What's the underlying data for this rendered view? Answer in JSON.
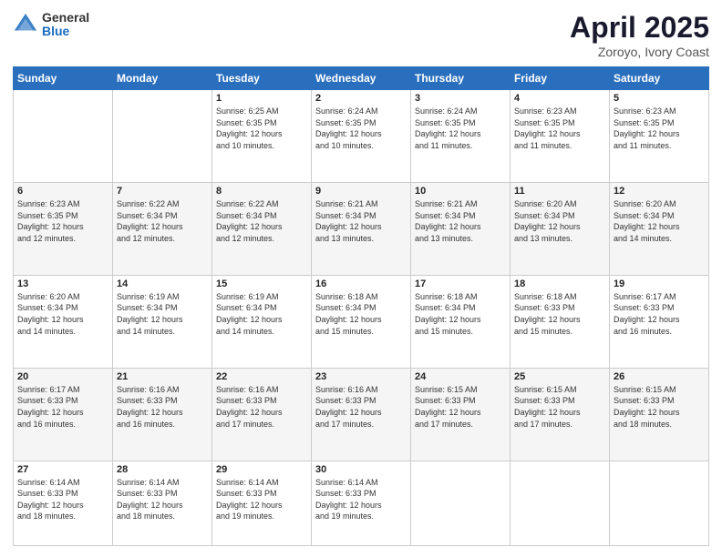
{
  "logo": {
    "general": "General",
    "blue": "Blue"
  },
  "title": "April 2025",
  "location": "Zoroyo, Ivory Coast",
  "days_header": [
    "Sunday",
    "Monday",
    "Tuesday",
    "Wednesday",
    "Thursday",
    "Friday",
    "Saturday"
  ],
  "weeks": [
    [
      {
        "day": "",
        "info": ""
      },
      {
        "day": "",
        "info": ""
      },
      {
        "day": "1",
        "info": "Sunrise: 6:25 AM\nSunset: 6:35 PM\nDaylight: 12 hours\nand 10 minutes."
      },
      {
        "day": "2",
        "info": "Sunrise: 6:24 AM\nSunset: 6:35 PM\nDaylight: 12 hours\nand 10 minutes."
      },
      {
        "day": "3",
        "info": "Sunrise: 6:24 AM\nSunset: 6:35 PM\nDaylight: 12 hours\nand 11 minutes."
      },
      {
        "day": "4",
        "info": "Sunrise: 6:23 AM\nSunset: 6:35 PM\nDaylight: 12 hours\nand 11 minutes."
      },
      {
        "day": "5",
        "info": "Sunrise: 6:23 AM\nSunset: 6:35 PM\nDaylight: 12 hours\nand 11 minutes."
      }
    ],
    [
      {
        "day": "6",
        "info": "Sunrise: 6:23 AM\nSunset: 6:35 PM\nDaylight: 12 hours\nand 12 minutes."
      },
      {
        "day": "7",
        "info": "Sunrise: 6:22 AM\nSunset: 6:34 PM\nDaylight: 12 hours\nand 12 minutes."
      },
      {
        "day": "8",
        "info": "Sunrise: 6:22 AM\nSunset: 6:34 PM\nDaylight: 12 hours\nand 12 minutes."
      },
      {
        "day": "9",
        "info": "Sunrise: 6:21 AM\nSunset: 6:34 PM\nDaylight: 12 hours\nand 13 minutes."
      },
      {
        "day": "10",
        "info": "Sunrise: 6:21 AM\nSunset: 6:34 PM\nDaylight: 12 hours\nand 13 minutes."
      },
      {
        "day": "11",
        "info": "Sunrise: 6:20 AM\nSunset: 6:34 PM\nDaylight: 12 hours\nand 13 minutes."
      },
      {
        "day": "12",
        "info": "Sunrise: 6:20 AM\nSunset: 6:34 PM\nDaylight: 12 hours\nand 14 minutes."
      }
    ],
    [
      {
        "day": "13",
        "info": "Sunrise: 6:20 AM\nSunset: 6:34 PM\nDaylight: 12 hours\nand 14 minutes."
      },
      {
        "day": "14",
        "info": "Sunrise: 6:19 AM\nSunset: 6:34 PM\nDaylight: 12 hours\nand 14 minutes."
      },
      {
        "day": "15",
        "info": "Sunrise: 6:19 AM\nSunset: 6:34 PM\nDaylight: 12 hours\nand 14 minutes."
      },
      {
        "day": "16",
        "info": "Sunrise: 6:18 AM\nSunset: 6:34 PM\nDaylight: 12 hours\nand 15 minutes."
      },
      {
        "day": "17",
        "info": "Sunrise: 6:18 AM\nSunset: 6:34 PM\nDaylight: 12 hours\nand 15 minutes."
      },
      {
        "day": "18",
        "info": "Sunrise: 6:18 AM\nSunset: 6:33 PM\nDaylight: 12 hours\nand 15 minutes."
      },
      {
        "day": "19",
        "info": "Sunrise: 6:17 AM\nSunset: 6:33 PM\nDaylight: 12 hours\nand 16 minutes."
      }
    ],
    [
      {
        "day": "20",
        "info": "Sunrise: 6:17 AM\nSunset: 6:33 PM\nDaylight: 12 hours\nand 16 minutes."
      },
      {
        "day": "21",
        "info": "Sunrise: 6:16 AM\nSunset: 6:33 PM\nDaylight: 12 hours\nand 16 minutes."
      },
      {
        "day": "22",
        "info": "Sunrise: 6:16 AM\nSunset: 6:33 PM\nDaylight: 12 hours\nand 17 minutes."
      },
      {
        "day": "23",
        "info": "Sunrise: 6:16 AM\nSunset: 6:33 PM\nDaylight: 12 hours\nand 17 minutes."
      },
      {
        "day": "24",
        "info": "Sunrise: 6:15 AM\nSunset: 6:33 PM\nDaylight: 12 hours\nand 17 minutes."
      },
      {
        "day": "25",
        "info": "Sunrise: 6:15 AM\nSunset: 6:33 PM\nDaylight: 12 hours\nand 17 minutes."
      },
      {
        "day": "26",
        "info": "Sunrise: 6:15 AM\nSunset: 6:33 PM\nDaylight: 12 hours\nand 18 minutes."
      }
    ],
    [
      {
        "day": "27",
        "info": "Sunrise: 6:14 AM\nSunset: 6:33 PM\nDaylight: 12 hours\nand 18 minutes."
      },
      {
        "day": "28",
        "info": "Sunrise: 6:14 AM\nSunset: 6:33 PM\nDaylight: 12 hours\nand 18 minutes."
      },
      {
        "day": "29",
        "info": "Sunrise: 6:14 AM\nSunset: 6:33 PM\nDaylight: 12 hours\nand 19 minutes."
      },
      {
        "day": "30",
        "info": "Sunrise: 6:14 AM\nSunset: 6:33 PM\nDaylight: 12 hours\nand 19 minutes."
      },
      {
        "day": "",
        "info": ""
      },
      {
        "day": "",
        "info": ""
      },
      {
        "day": "",
        "info": ""
      }
    ]
  ]
}
